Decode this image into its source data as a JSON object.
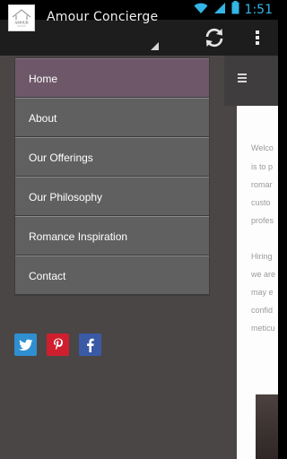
{
  "status_bar": {
    "time": "1:51"
  },
  "action_bar": {
    "logo_text": "AMOUR",
    "title": "Amour Concierge"
  },
  "page": {
    "lines": [
      "Welco",
      "is to p",
      "romar",
      "custo",
      "profes",
      "",
      "Hiring",
      "we are",
      "may e",
      "confid",
      "meticu"
    ]
  },
  "drawer": {
    "items": [
      {
        "label": "Home",
        "active": true
      },
      {
        "label": "About"
      },
      {
        "label": "Our Offerings"
      },
      {
        "label": "Our Philosophy"
      },
      {
        "label": "Romance Inspiration"
      },
      {
        "label": "Contact"
      }
    ]
  },
  "social": {
    "twitter_color": "#2f8fd0",
    "pinterest_color": "#cf1f2f",
    "facebook_color": "#3b5aa5"
  },
  "colors": {
    "accent": "#33b5e5",
    "active_item": "#6e5769"
  }
}
